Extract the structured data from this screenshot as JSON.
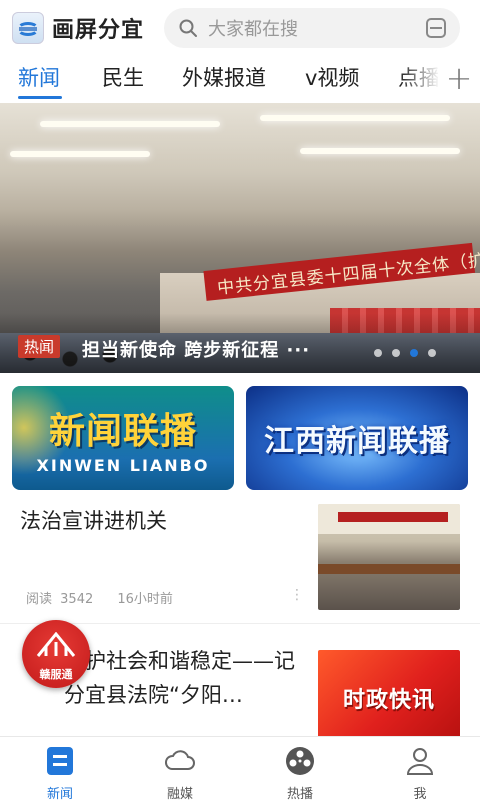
{
  "app": {
    "name": "画屏分宜"
  },
  "search": {
    "placeholder": "大家都在搜"
  },
  "tabs": [
    {
      "label": "新闻",
      "active": true
    },
    {
      "label": "民生"
    },
    {
      "label": "外媒报道"
    },
    {
      "label": "v视频"
    },
    {
      "label": "点播"
    }
  ],
  "banner": {
    "tag": "热闻",
    "caption": "担当新使命 跨步新征程 ···",
    "photo_banner_text": "中共分宜县委十四届十次全体（扩大）会议",
    "slide_count": 4,
    "active_slide": 3
  },
  "shortcuts": [
    {
      "title": "新闻联播",
      "subtitle": "XINWEN LIANBO"
    },
    {
      "title": "江西新闻联播"
    }
  ],
  "news": [
    {
      "title": "法治宣讲进机关",
      "reads_label": "阅读",
      "reads": "3542",
      "time": "16小时前"
    },
    {
      "title": "维护社会和谐稳定——记分宜县法院“夕阳…",
      "title_prefix_hidden": "…",
      "thumb_text": "时政快讯"
    }
  ],
  "float_badge": {
    "label": "赣服通"
  },
  "bottom_nav": [
    {
      "label": "新闻",
      "active": true
    },
    {
      "label": "融媒"
    },
    {
      "label": "热播"
    },
    {
      "label": "我"
    }
  ],
  "colors": {
    "accent": "#2277d9",
    "hot_tag": "#c93a2b"
  }
}
